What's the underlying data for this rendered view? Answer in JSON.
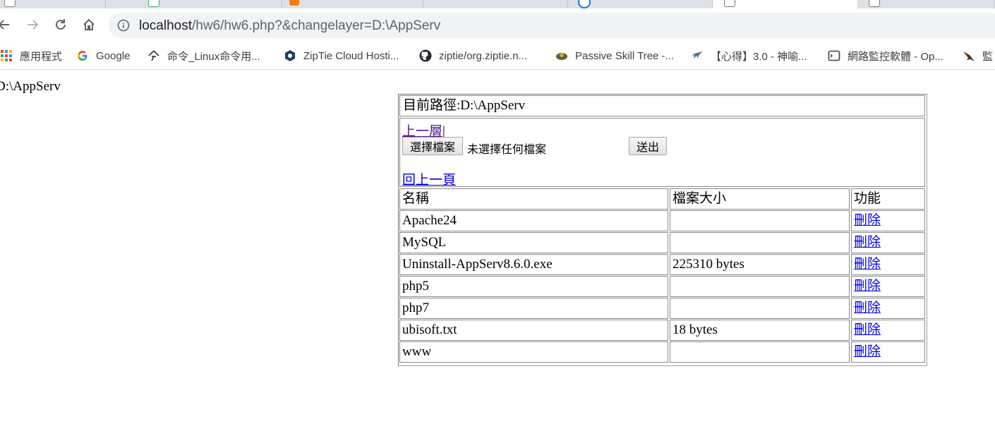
{
  "browser": {
    "url_host": "localhost",
    "url_path": "/hw6/hw6.php?&changelayer=D:\\AppServ",
    "bookmarks": [
      {
        "label": "應用程式",
        "icon": "apps-grid-icon"
      },
      {
        "label": "Google",
        "icon": "google-icon"
      },
      {
        "label": "命令_Linux命令用...",
        "icon": "command-icon"
      },
      {
        "label": "ZipTie Cloud Hosti...",
        "icon": "ziptie-icon"
      },
      {
        "label": "ziptie/org.ziptie.n...",
        "icon": "github-icon"
      },
      {
        "label": "Passive Skill Tree -...",
        "icon": "skill-tree-icon"
      },
      {
        "label": "【心得】3.0 - 神喻...",
        "icon": "bird-icon"
      },
      {
        "label": "網路監控軟體 - Op...",
        "icon": "monitor-icon"
      },
      {
        "label": "監",
        "icon": "hawk-icon"
      }
    ]
  },
  "page": {
    "path_echo": "D:\\AppServ",
    "current_path_label": "目前路徑:D:\\AppServ",
    "up_link": "上一層",
    "up_link_separator": "|",
    "choose_file_label": "選擇檔案",
    "no_file_text": "未選擇任何檔案",
    "submit_label": "送出",
    "back_link": "回上一頁",
    "columns": {
      "name": "名稱",
      "size": "檔案大小",
      "action": "功能"
    },
    "rows": [
      {
        "name": "Apache24",
        "size": "",
        "action": "刪除"
      },
      {
        "name": "MySQL",
        "size": "",
        "action": "刪除"
      },
      {
        "name": "Uninstall-AppServ8.6.0.exe",
        "size": "225310 bytes",
        "action": "刪除"
      },
      {
        "name": "php5",
        "size": "",
        "action": "刪除"
      },
      {
        "name": "php7",
        "size": "",
        "action": "刪除"
      },
      {
        "name": "ubisoft.txt",
        "size": "18 bytes",
        "action": "刪除"
      },
      {
        "name": "www",
        "size": "",
        "action": "刪除"
      }
    ]
  }
}
